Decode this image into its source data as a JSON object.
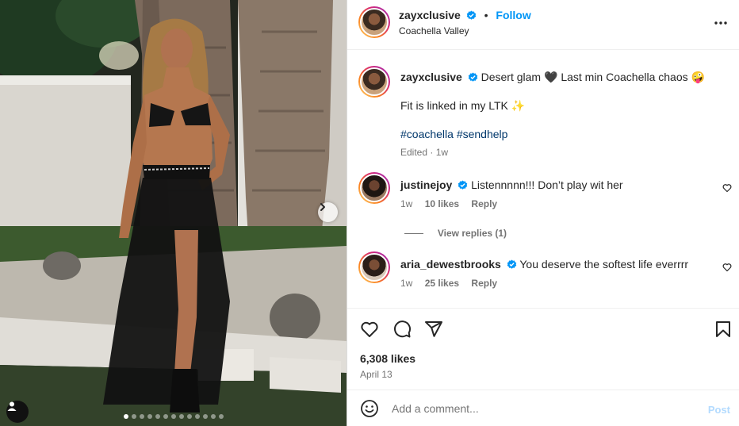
{
  "post": {
    "username": "zayxclusive",
    "follow_label": "Follow",
    "location": "Coachella Valley",
    "separator": "•"
  },
  "caption": {
    "username": "zayxclusive",
    "line1_text": "Desert glam",
    "line1_text2": "Last min Coachella chaos",
    "line1_emoji_heart": "🖤",
    "line1_emoji_face": "🤪",
    "line2_text": "Fit is linked in my LTK",
    "line2_emoji": "✨",
    "hashtag1": "#coachella",
    "hashtag2": "#sendhelp",
    "meta": "Edited · 1w"
  },
  "comments": [
    {
      "username": "justinejoy",
      "text": "Listennnnn!!! Don’t play wit her",
      "time": "1w",
      "likes": "10 likes",
      "reply_label": "Reply"
    },
    {
      "username": "aria_dewestbrooks",
      "text": "You deserve the softest life everrrr",
      "time": "1w",
      "likes": "25 likes",
      "reply_label": "Reply"
    }
  ],
  "view_replies": "View replies (1)",
  "stats": {
    "likes": "6,308 likes",
    "date": "April 13"
  },
  "comment_box": {
    "placeholder": "Add a comment...",
    "post_label": "Post"
  },
  "carousel": {
    "total": 13,
    "active_index": 0
  },
  "colors": {
    "accent": "#0095f6",
    "verified": "#0095f6",
    "hashtag": "#00376b",
    "muted": "#737373",
    "post_disabled": "#b3dbff"
  },
  "icons": [
    "verified-badge-icon",
    "more-options-icon",
    "heart-icon",
    "comment-icon",
    "share-icon",
    "bookmark-icon",
    "emoji-icon",
    "chevron-right-icon",
    "user-tag-icon"
  ]
}
